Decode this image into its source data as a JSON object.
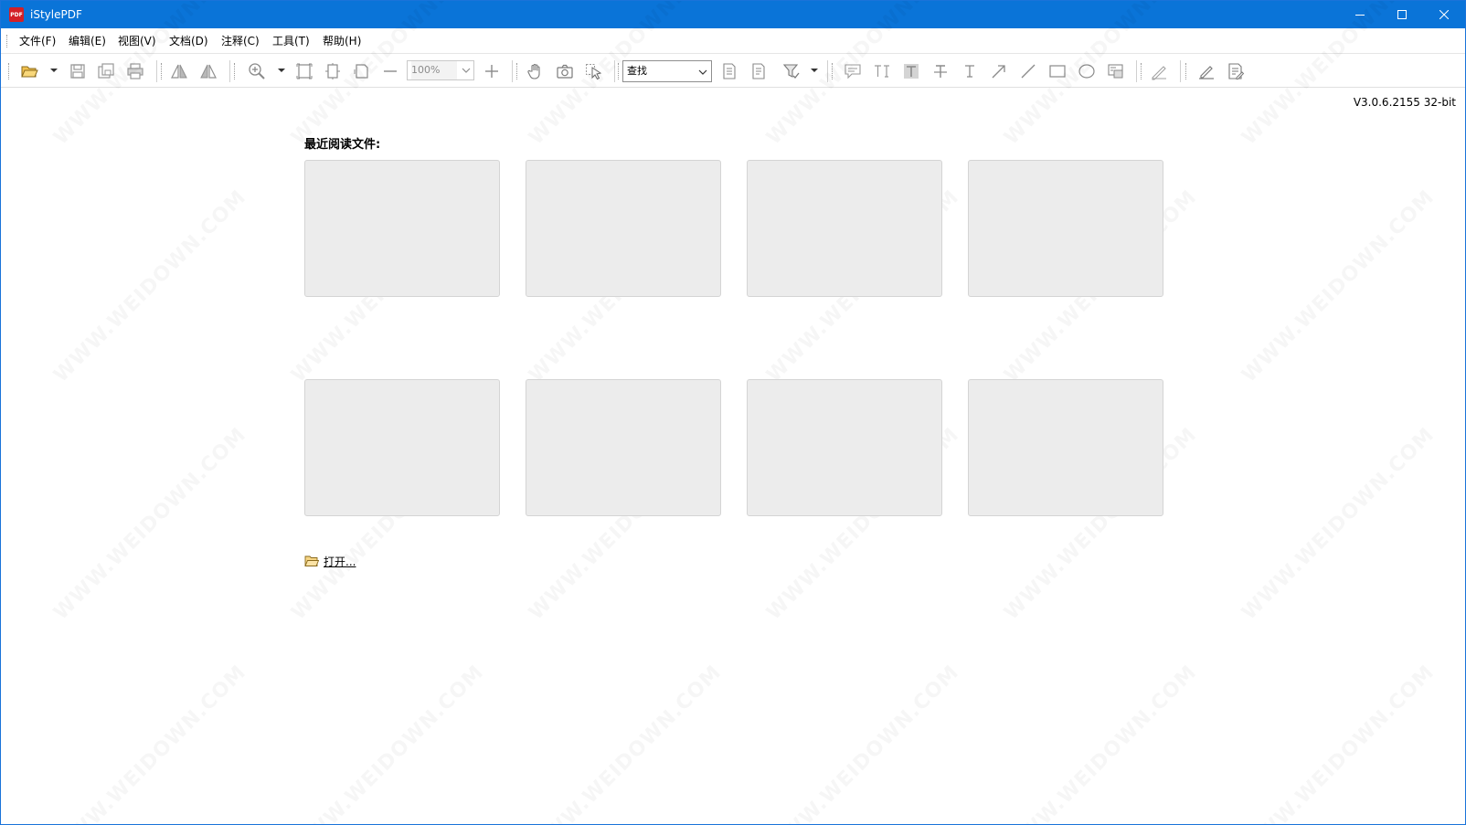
{
  "window": {
    "app_logo_text": "PDF",
    "title": "iStylePDF"
  },
  "menu": {
    "items": [
      "文件(F)",
      "编辑(E)",
      "视图(V)",
      "文档(D)",
      "注释(C)",
      "工具(T)",
      "帮助(H)"
    ]
  },
  "toolbar": {
    "zoom_value": "100%",
    "find_value": "查找"
  },
  "main": {
    "version": "V3.0.6.2155 32-bit",
    "recent_title": "最近阅读文件:",
    "recent_file_slots": 8,
    "open_label": "打开..."
  },
  "watermark": {
    "text": "WWW.WEIDOWN.COM"
  },
  "colors": {
    "titlebar": "#0a74d8",
    "thumbnail_bg": "#ececec",
    "app_logo": "#d32027"
  }
}
